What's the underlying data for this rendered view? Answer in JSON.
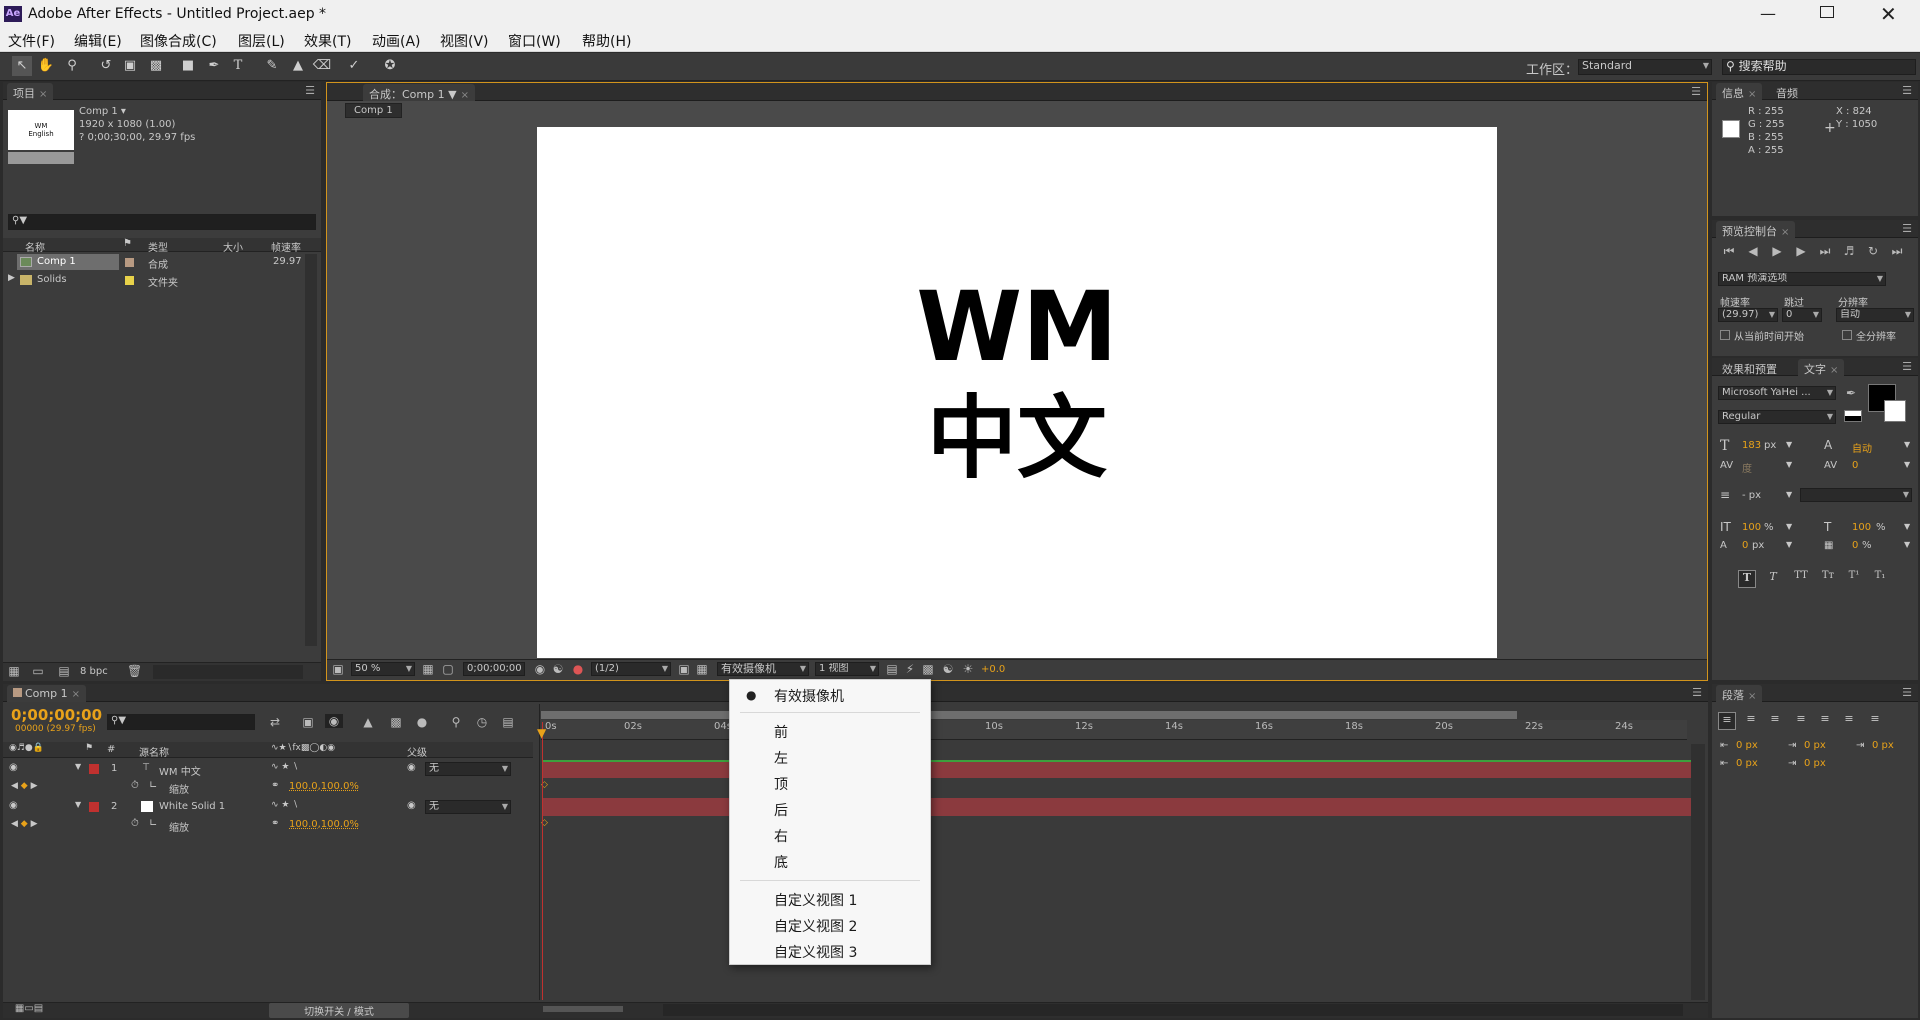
{
  "window": {
    "title": "Adobe After Effects - Untitled Project.aep *",
    "app_icon": "Ae"
  },
  "menu": [
    "文件(F)",
    "编辑(E)",
    "图像合成(C)",
    "图层(L)",
    "效果(T)",
    "动画(A)",
    "视图(V)",
    "窗口(W)",
    "帮助(H)"
  ],
  "toolbar": {
    "workspace_label": "工作区：",
    "workspace_value": "Standard",
    "search_placeholder": "搜索帮助"
  },
  "project": {
    "tab": "项目",
    "comp_name": "Comp 1 ▾",
    "comp_size": "1920 x 1080 (1.00)",
    "comp_duration": "? 0;00;30;00, 29.97 fps",
    "thumb_text": "WM\nEnglish",
    "columns": [
      "名称",
      "类型",
      "大小",
      "帧速率"
    ],
    "items": [
      {
        "name": "Comp 1",
        "type": "合成",
        "size": "",
        "fps": "29.97"
      },
      {
        "name": "Solids",
        "type": "文件夹",
        "size": "",
        "fps": ""
      }
    ],
    "bpc": "8 bpc"
  },
  "composition": {
    "tab": "合成：Comp 1",
    "subtab": "Comp 1",
    "canvas_line1": "WM",
    "canvas_line2": "中文",
    "zoom": "50 %",
    "timecode": "0;00;00;00",
    "resolution": "(1/2)",
    "camera": "有效摄像机",
    "views": "1 视图",
    "exposure": "+0.0"
  },
  "camera_menu": {
    "items_top": [
      "有效摄像机"
    ],
    "items_mid": [
      "前",
      "左",
      "顶",
      "后",
      "右",
      "底"
    ],
    "items_bottom": [
      "自定义视图 1",
      "自定义视图 2",
      "自定义视图 3"
    ]
  },
  "info": {
    "tab1": "信息",
    "tab2": "音频",
    "r": "R : 255",
    "g": "G : 255",
    "b": "B : 255",
    "a": "A : 255",
    "x": "X : 824",
    "y": "Y : 1050"
  },
  "preview": {
    "tab": "预览控制台",
    "ram": "RAM 预演选项",
    "labels": [
      "帧速率",
      "跳过",
      "分辨率"
    ],
    "fps": "(29.97)",
    "skip": "0",
    "res": "自动",
    "from_current": "从当前时间开始",
    "full_screen": "全分辨率"
  },
  "character": {
    "tab1": "效果和预置",
    "tab2": "文字",
    "font": "Microsoft YaHei ...",
    "style": "Regular",
    "size": "183",
    "size_unit": "px",
    "leading": "自动",
    "kerning": "度",
    "tracking": "0",
    "stroke": "- px",
    "vscale": "100",
    "hscale": "100",
    "pct": "%",
    "baseline": "0",
    "baseline_unit": "px",
    "tsume": "0",
    "tsume_unit": "%"
  },
  "paragraph": {
    "tab": "段落",
    "values": [
      "0 px",
      "0 px",
      "0 px",
      "0 px",
      "0 px"
    ]
  },
  "timeline": {
    "tab": "Comp 1",
    "timecode": "0;00;00;00",
    "frames": "00000 (29.97 fps)",
    "col_source": "源名称",
    "col_parent": "父级",
    "hash": "#",
    "layers": [
      {
        "num": "1",
        "name": "WM 中文",
        "parent": "无",
        "prop": "缩放",
        "value": "100.0,100.0%"
      },
      {
        "num": "2",
        "name": "White Solid 1",
        "parent": "无",
        "prop": "缩放",
        "value": "100.0,100.0%"
      }
    ],
    "ticks": [
      "0s",
      "02s",
      "04s",
      "10s",
      "12s",
      "14s",
      "16s",
      "18s",
      "20s",
      "22s",
      "24s"
    ],
    "switch_mode": "切换开关 / 模式"
  },
  "colors": {
    "accent": "#e8a21a",
    "layer_bar": "#8b3a3e",
    "label_red": "#c0312f"
  }
}
